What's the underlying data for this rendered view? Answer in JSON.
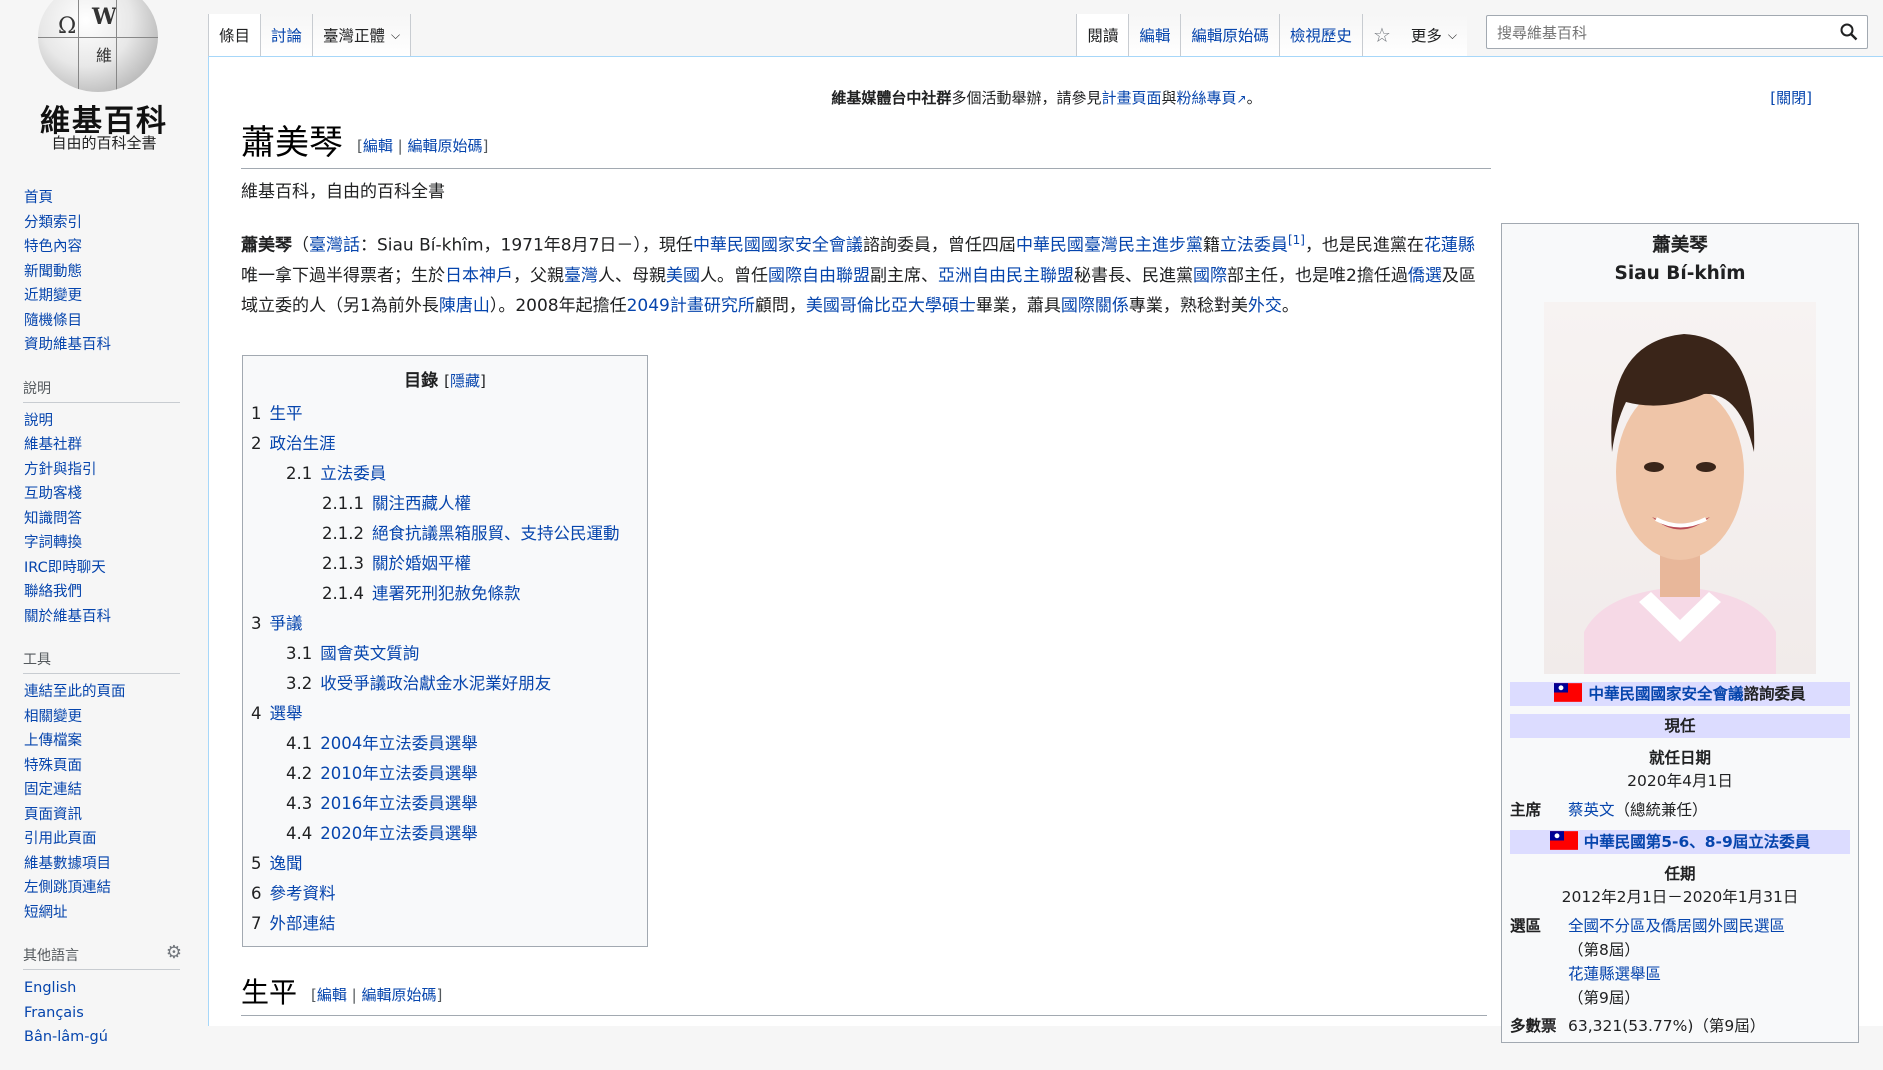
{
  "logo": {
    "name": "維基百科",
    "tagline": "自由的百科全書",
    "globe_glyphs": [
      "Ω",
      "W",
      "維"
    ]
  },
  "sidebar": {
    "nav": [
      "首頁",
      "分類索引",
      "特色內容",
      "新聞動態",
      "近期變更",
      "隨機條目",
      "資助維基百科"
    ],
    "help_heading": "說明",
    "help": [
      "說明",
      "維基社群",
      "方針與指引",
      "互助客棧",
      "知識問答",
      "字詞轉換",
      "IRC即時聊天",
      "聯絡我們",
      "關於維基百科"
    ],
    "tools_heading": "工具",
    "tools": [
      "連結至此的頁面",
      "相關變更",
      "上傳檔案",
      "特殊頁面",
      "固定連結",
      "頁面資訊",
      "引用此頁面",
      "維基數據項目",
      "左側跳頂連結",
      "短網址"
    ],
    "lang_heading": "其他語言",
    "langs": [
      "English",
      "Français",
      "Bân-lâm-gú"
    ]
  },
  "tabs": {
    "article": "條目",
    "talk": "討論",
    "variant": "臺灣正體",
    "read": "閱讀",
    "edit": "編輯",
    "edit_source": "編輯原始碼",
    "history": "檢視歷史",
    "more": "更多"
  },
  "search": {
    "placeholder": "搜尋維基百科"
  },
  "notice": {
    "bold": "維基媒體台中社群",
    "t1": "多個活動舉辦，請參見",
    "link1": "計畫頁面",
    "t2": "與",
    "link2": "粉絲專頁",
    "t3": "。",
    "dismiss": "[關閉]"
  },
  "article": {
    "title": "蕭美琴",
    "edit": "編輯",
    "edit_source": "編輯原始碼",
    "site_sub": "維基百科，自由的百科全書",
    "lead": [
      {
        "t": "蕭美琴",
        "b": true
      },
      {
        "t": "（"
      },
      {
        "t": "臺灣話",
        "a": true
      },
      {
        "t": "：Siau Bí-khîm，1971年8月7日－），現任"
      },
      {
        "t": "中華民國國家安全會議",
        "a": true
      },
      {
        "t": "諮詢委員，曾任四屆"
      },
      {
        "t": "中華民國",
        "a": true
      },
      {
        "t": "臺灣",
        "a": true
      },
      {
        "t": "民主進步黨",
        "a": true
      },
      {
        "t": "籍"
      },
      {
        "t": "立法委員",
        "a": true
      },
      {
        "t": "[1]",
        "a": true,
        "sup": true
      },
      {
        "t": "，也是民進黨在"
      },
      {
        "t": "花蓮縣",
        "a": true
      },
      {
        "t": "唯一拿下過半得票者；生於"
      },
      {
        "t": "日本",
        "a": true
      },
      {
        "t": "神戶",
        "a": true
      },
      {
        "t": "，父親"
      },
      {
        "t": "臺灣",
        "a": true
      },
      {
        "t": "人、母親"
      },
      {
        "t": "美國",
        "a": true
      },
      {
        "t": "人。曾任"
      },
      {
        "t": "國際自由聯盟",
        "a": true
      },
      {
        "t": "副主席、"
      },
      {
        "t": "亞洲自由民主聯盟",
        "a": true
      },
      {
        "t": "秘書長、民進黨"
      },
      {
        "t": "國際",
        "a": true
      },
      {
        "t": "部主任，也是唯2擔任過"
      },
      {
        "t": "僑選",
        "a": true
      },
      {
        "t": "及區域立委的人（另1為前外長"
      },
      {
        "t": "陳唐山",
        "a": true
      },
      {
        "t": "）。2008年起擔任"
      },
      {
        "t": "2049計畫研究所",
        "a": true
      },
      {
        "t": "顧問，"
      },
      {
        "t": "美國",
        "a": true
      },
      {
        "t": "哥倫比亞大學",
        "a": true
      },
      {
        "t": "碩士",
        "a": true
      },
      {
        "t": "畢業，蕭具"
      },
      {
        "t": "國際關係",
        "a": true
      },
      {
        "t": "專業，熟稔對美"
      },
      {
        "t": "外交",
        "a": true
      },
      {
        "t": "。"
      }
    ],
    "section1": "生平"
  },
  "toc": {
    "title": "目錄",
    "toggle": "隱藏",
    "items": [
      {
        "level": 1,
        "num": "1",
        "text": "生平"
      },
      {
        "level": 1,
        "num": "2",
        "text": "政治生涯"
      },
      {
        "level": 2,
        "num": "2.1",
        "text": "立法委員"
      },
      {
        "level": 3,
        "num": "2.1.1",
        "text": "關注西藏人權"
      },
      {
        "level": 3,
        "num": "2.1.2",
        "text": "絕食抗議黑箱服貿、支持公民運動"
      },
      {
        "level": 3,
        "num": "2.1.3",
        "text": "關於婚姻平權"
      },
      {
        "level": 3,
        "num": "2.1.4",
        "text": "連署死刑犯赦免條款"
      },
      {
        "level": 1,
        "num": "3",
        "text": "爭議"
      },
      {
        "level": 2,
        "num": "3.1",
        "text": "國會英文質詢"
      },
      {
        "level": 2,
        "num": "3.2",
        "text": "收受爭議政治獻金水泥業好朋友"
      },
      {
        "level": 1,
        "num": "4",
        "text": "選舉"
      },
      {
        "level": 2,
        "num": "4.1",
        "text": "2004年立法委員選舉"
      },
      {
        "level": 2,
        "num": "4.2",
        "text": "2010年立法委員選舉"
      },
      {
        "level": 2,
        "num": "4.3",
        "text": "2016年立法委員選舉"
      },
      {
        "level": 2,
        "num": "4.4",
        "text": "2020年立法委員選舉"
      },
      {
        "level": 1,
        "num": "5",
        "text": "逸聞"
      },
      {
        "level": 1,
        "num": "6",
        "text": "參考資料"
      },
      {
        "level": 1,
        "num": "7",
        "text": "外部連結"
      }
    ]
  },
  "infobox": {
    "name": "蕭美琴",
    "romanized": "Siau Bí-khîm",
    "office1": {
      "link": "中華民國國家安全會議",
      "suffix": "諮詢委員"
    },
    "current": "現任",
    "start_label": "就任日期",
    "start": "2020年4月1日",
    "chair_label": "主席",
    "chair_link": "蔡英文",
    "chair_note": "（總統兼任）",
    "office2": {
      "prefix": "中華民國第5-6、8-9屆",
      "link": "立法委員"
    },
    "term_label": "任期",
    "term": "2012年2月1日－2020年1月31日",
    "district_label": "選區",
    "district1": "全國不分區及僑居國外國民選區",
    "district1_note": "（第8屆）",
    "district2": "花蓮縣選舉區",
    "district2_note": "（第9屆）",
    "votes_label": "多數票",
    "votes": "63,321(53.77%)（第9屆）",
    "flag_colors": {
      "red": "#fe0000",
      "blue": "#000095",
      "white": "#ffffff"
    }
  }
}
